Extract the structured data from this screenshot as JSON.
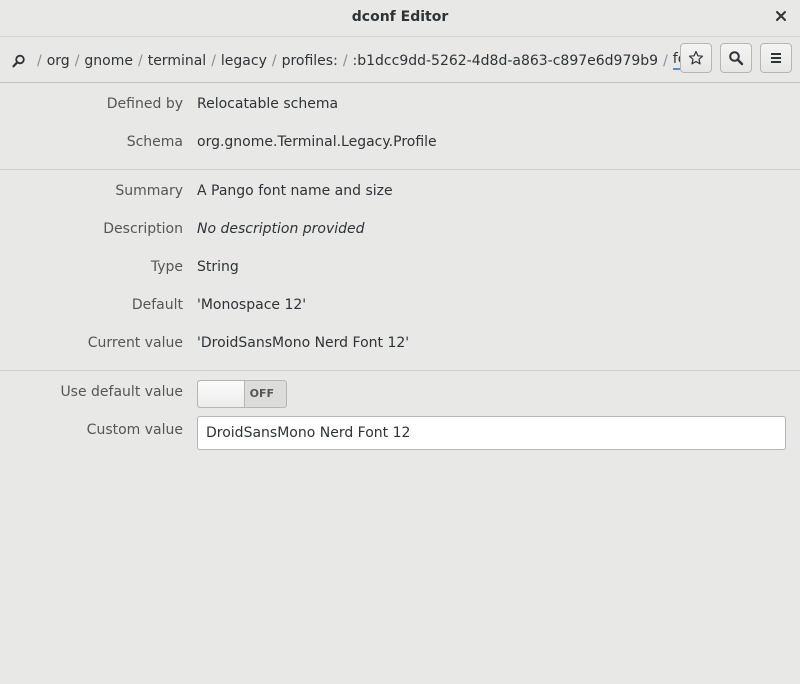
{
  "window": {
    "title": "dconf Editor"
  },
  "pathbar": {
    "segments": [
      "org",
      "gnome",
      "terminal",
      "legacy",
      "profiles:",
      ":b1dcc9dd-5262-4d8d-a863-c897e6d979b9",
      "font"
    ],
    "separator": "/"
  },
  "header_buttons": {
    "bookmark_icon": "star-icon",
    "search_icon": "search-icon",
    "menu_icon": "hamburger-menu-icon"
  },
  "schema_info": {
    "defined_by_label": "Defined by",
    "defined_by_value": "Relocatable schema",
    "schema_label": "Schema",
    "schema_value": "org.gnome.Terminal.Legacy.Profile"
  },
  "key_info": {
    "summary_label": "Summary",
    "summary_value": "A Pango font name and size",
    "description_label": "Description",
    "description_value": "No description provided",
    "type_label": "Type",
    "type_value": "String",
    "default_label": "Default",
    "default_value": "'Monospace 12'",
    "current_label": "Current value",
    "current_value": "'DroidSansMono Nerd Font 12'"
  },
  "editor": {
    "use_default_label": "Use default value",
    "use_default_state": "OFF",
    "custom_value_label": "Custom value",
    "custom_value": "DroidSansMono Nerd Font 12"
  },
  "colors": {
    "background": "#e8e8e7",
    "accent": "#4a90d9",
    "text": "#2e3436",
    "label": "#555753"
  }
}
